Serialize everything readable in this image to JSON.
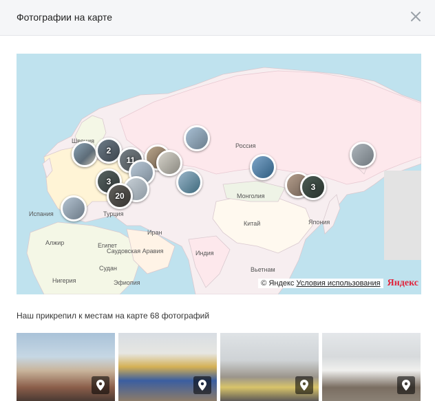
{
  "header": {
    "title": "Фотографии на карте"
  },
  "map": {
    "labels": {
      "sweden": "Швеция",
      "russia": "Россия",
      "spain": "Испания",
      "turkey": "Турция",
      "mongolia": "Монголия",
      "iran": "Иран",
      "china": "Китай",
      "japan": "Япония",
      "algeria": "Алжир",
      "egypt": "Египет",
      "saudi": "Саудовская Аравия",
      "india": "Индия",
      "sudan": "Судан",
      "vietnam": "Вьетнам",
      "nigeria": "Нигерия",
      "ethiopia": "Эфиопия"
    },
    "clusters": {
      "c2": "2",
      "c11": "11",
      "c3a": "3",
      "c20": "20",
      "c3b": "3"
    },
    "attribution": {
      "copyright": "© Яндекс",
      "terms": "Условия использования",
      "logo": "Яндекс"
    }
  },
  "caption": "Наш прикрепил к местам на карте 68 фотографий",
  "colors": {
    "water": "#bfe2ee",
    "land": "#f7eef0",
    "russia": "#fde8ec",
    "pin_bg": "#000000"
  }
}
